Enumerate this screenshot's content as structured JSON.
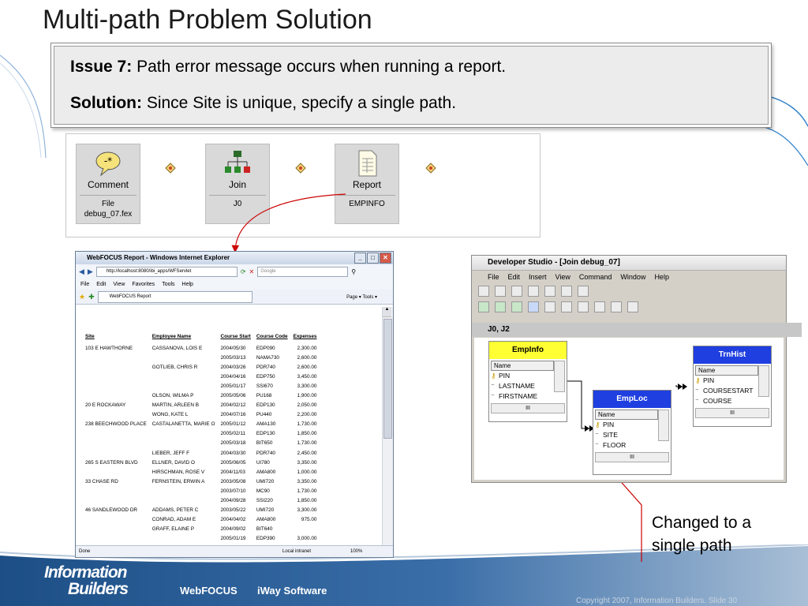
{
  "slide": {
    "title": "Multi-path Problem Solution",
    "issue_label": "Issue 7:",
    "issue_text": "Path error message occurs when running a report.",
    "solution_label": "Solution:",
    "solution_text": "Since Site is unique, specify a single path.",
    "callout": [
      "Changed to a",
      "single path"
    ],
    "footer": {
      "logo_line1": "Information",
      "logo_line2": "Builders",
      "product1": "WebFOCUS",
      "product2": "iWay Software",
      "copyright": "Copyright 2007, Information Builders. Slide 30"
    }
  },
  "flow": {
    "items": [
      {
        "label": "Comment",
        "sub": [
          "File",
          "debug_07.fex"
        ],
        "icon": "comment-icon"
      },
      {
        "label": "Join",
        "sub": [
          "J0"
        ],
        "icon": "join-icon"
      },
      {
        "label": "Report",
        "sub": [
          "EMPINFO"
        ],
        "icon": "report-icon"
      }
    ]
  },
  "ie": {
    "title": "WebFOCUS Report - Windows Internet Explorer",
    "url": "http://localhost:8080/ibi_apps/WFServlet",
    "search_placeholder": "Google",
    "menu": [
      "File",
      "Edit",
      "View",
      "Favorites",
      "Tools",
      "Help"
    ],
    "tab": "WebFOCUS Report",
    "tools": "Page  ▾  Tools ▾",
    "status_left": "Done",
    "status_zone": "Local intranet",
    "status_zoom": "100%",
    "report": {
      "columns": [
        "Site",
        "Employee Name",
        "Course Start",
        "Course Code",
        "Expenses"
      ],
      "rows": [
        [
          "103 E HAWTHORNE",
          "CASSANOVA, LOIS E",
          "2004/05/30",
          "EDP090",
          "2,300.00"
        ],
        [
          "",
          "",
          "2005/03/13",
          "NAMA730",
          "2,600.00"
        ],
        [
          "",
          "GOTLIEB, CHRIS R",
          "2004/03/26",
          "PDR740",
          "2,600.00"
        ],
        [
          "",
          "",
          "2004/04/16",
          "EDP750",
          "3,450.00"
        ],
        [
          "",
          "",
          "2005/01/17",
          "SSI670",
          "3,300.00"
        ],
        [
          "",
          "OLSON, WILMA P",
          "2005/05/06",
          "PU168",
          "1,900.00"
        ],
        [
          "20 E ROCKAWAY",
          "MARTIN, ARLEEN B",
          "2004/02/12",
          "EDP130",
          "2,050.00"
        ],
        [
          "",
          "WONG, KATE L",
          "2004/07/16",
          "PU440",
          "2,200.00"
        ],
        [
          "238 BEECHWOOD PLACE",
          "CASTALANETTA, MARIE O",
          "2005/01/12",
          "AMA130",
          "1,730.00"
        ],
        [
          "",
          "",
          "2005/02/11",
          "EDP130",
          "1,850.00"
        ],
        [
          "",
          "",
          "2005/03/18",
          "BIT650",
          "1,730.00"
        ],
        [
          "",
          "LIEBER, JEFF F",
          "2004/03/30",
          "PDR740",
          "2,450.00"
        ],
        [
          "265 S EASTERN BLVD",
          "ELLNER, DAVID O",
          "2005/06/05",
          "UI780",
          "3,350.00"
        ],
        [
          "",
          "HIRSCHMAN, ROSE V",
          "2004/11/03",
          "AMA800",
          "1,000.00"
        ],
        [
          "33 CHASE RD",
          "FERNSTEIN, ERWIN A",
          "2003/05/08",
          "UMI720",
          "3,350.00"
        ],
        [
          "",
          "",
          "2003/07/10",
          "MC90",
          "1,730.00"
        ],
        [
          "",
          "",
          "2004/09/28",
          "SSI220",
          "1,850.00"
        ],
        [
          "46 SANDLEWOOD DR",
          "ADDAMS, PETER C",
          "2003/05/22",
          "UMI720",
          "3,300.00"
        ],
        [
          "",
          "CONRAD, ADAM E",
          "2004/04/02",
          "AMA800",
          "975.00"
        ],
        [
          "",
          "GRAFF, ELAINE P",
          "2004/09/02",
          "BIT640",
          ""
        ],
        [
          "",
          "",
          "2005/01/19",
          "EDP390",
          "3,000.00"
        ]
      ]
    }
  },
  "ds": {
    "title": "Developer Studio - [Join debug_07]",
    "menu": [
      "File",
      "Edit",
      "Insert",
      "View",
      "Command",
      "Window",
      "Help"
    ],
    "pane_title": "J0, J2",
    "col_header": "Name",
    "segments": [
      {
        "name": "EmpInfo",
        "fields": [
          "PIN",
          "LASTNAME",
          "FIRSTNAME"
        ]
      },
      {
        "name": "EmpLoc",
        "fields": [
          "PIN",
          "SITE",
          "FLOOR"
        ]
      },
      {
        "name": "TrnHist",
        "fields": [
          "PIN",
          "COURSESTART",
          "COURSE"
        ]
      }
    ],
    "hscroll_glyph": "III"
  },
  "colors": {
    "accent_blue": "#1f3fe0",
    "accent_yellow": "#ffff33",
    "arrow_red": "#cc0000"
  }
}
